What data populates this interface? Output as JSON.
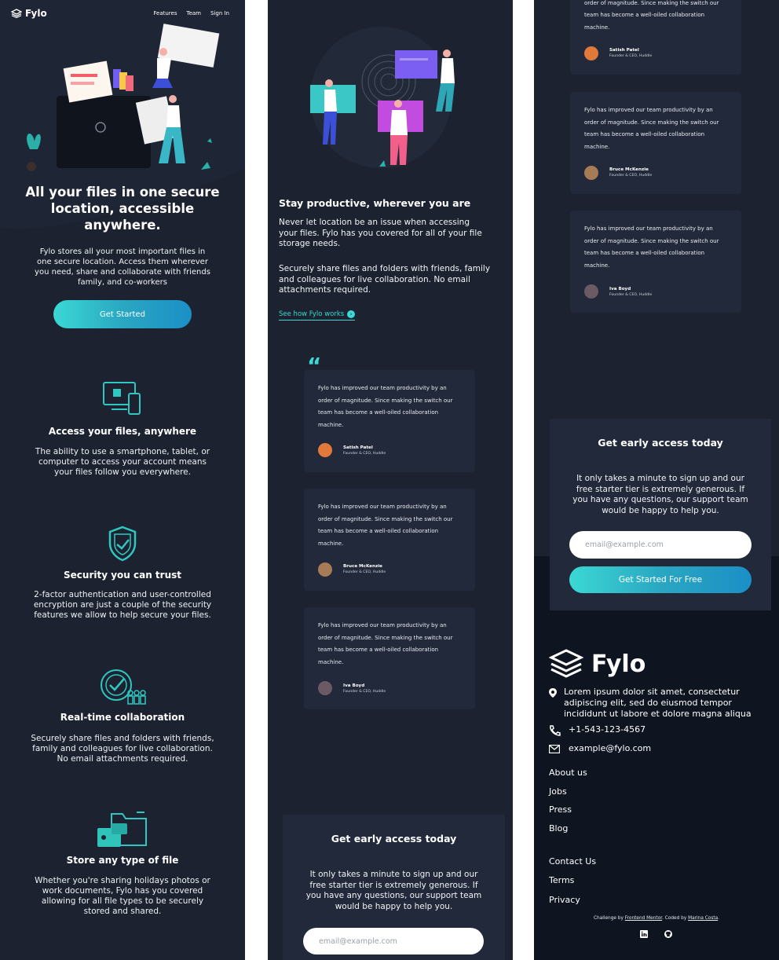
{
  "colors": {
    "panel_bg": "#1c2230",
    "card_bg": "#21293a",
    "footer_bg": "#0f1520",
    "accent": "#3bd8d4",
    "accent_dark": "#1b8fc6"
  },
  "header": {
    "logo": "Fylo",
    "nav": [
      "Features",
      "Team",
      "Sign In"
    ]
  },
  "hero": {
    "title_lines": [
      "All your files in one secure",
      "location, accessible",
      "anywhere."
    ],
    "text_lines": [
      "Fylo stores all your most important files in",
      "one secure location. Access them wherever",
      "you need, share and collaborate with friends",
      "family, and co-workers"
    ],
    "cta": "Get Started"
  },
  "features": [
    {
      "icon": "devices-icon",
      "title": "Access your files, anywhere",
      "lines": [
        "The ability to use a smartphone, tablet, or",
        "computer to access your account means",
        "your files follow you everywhere."
      ]
    },
    {
      "icon": "shield-icon",
      "title": "Security you can trust",
      "lines": [
        "2-factor authentication and user-controlled",
        "encryption are just a couple of the security",
        "features we allow to help secure your files."
      ]
    },
    {
      "icon": "collaboration-icon",
      "title": "Real-time collaboration",
      "lines": [
        "Securely share files and folders with friends,",
        "family and colleagues for live collaboration.",
        "No email attachments required."
      ]
    },
    {
      "icon": "folder-icon",
      "title": "Store any type of file",
      "lines": [
        "Whether you're sharing holidays photos or",
        "work documents, Fylo has you covered",
        "allowing for all file types to be securely",
        "stored and shared."
      ]
    }
  ],
  "productive": {
    "title": "Stay productive, wherever you are",
    "p1_lines": [
      "Never let location be an issue when accessing",
      "your files. Fylo has you covered for all of your file",
      "storage needs."
    ],
    "p2_lines": [
      "Securely share files and folders with friends, family",
      "and colleagues for live collaboration. No email",
      "attachments required."
    ],
    "link": "See how Fylo works"
  },
  "quote_mark": "“",
  "testimonial_lines": [
    "Fylo has improved our team productivity by an",
    "order of magnitude. Since making the switch our",
    "team has become a well-oiled collaboration",
    "machine."
  ],
  "testimonials": [
    {
      "name": "Satish Patel",
      "role": "Founder & CEO, Huddle",
      "avatar_color": "#e0793a"
    },
    {
      "name": "Bruce McKenzie",
      "role": "Founder & CEO, Huddle",
      "avatar_color": "#a77b55"
    },
    {
      "name": "Iva Boyd",
      "role": "Founder & CEO, Huddle",
      "avatar_color": "#6b5a63"
    }
  ],
  "early_access": {
    "title": "Get early access today",
    "lines": [
      "It only takes a minute to sign up and our",
      "free starter tier is extremely generous. If",
      "you have any questions, our support team",
      "would be happy to help you."
    ],
    "placeholder": "email@example.com",
    "button": "Get Started For Free"
  },
  "footer": {
    "logo": "Fylo",
    "address_lines": [
      "Lorem ipsum dolor sit amet, consectetur",
      "adipiscing elit, sed do eiusmod tempor",
      "incididunt ut labore et dolore magna aliqua"
    ],
    "phone": "+1-543-123-4567",
    "email": "example@fylo.com",
    "links1": [
      "About us",
      "Jobs",
      "Press",
      "Blog"
    ],
    "links2": [
      "Contact Us",
      "Terms",
      "Privacy"
    ],
    "attribution": {
      "prefix": "Challenge by ",
      "fm": "Frontend Mentor",
      "mid": ". Coded by ",
      "author": "Marina Costa",
      "suffix": "."
    }
  }
}
